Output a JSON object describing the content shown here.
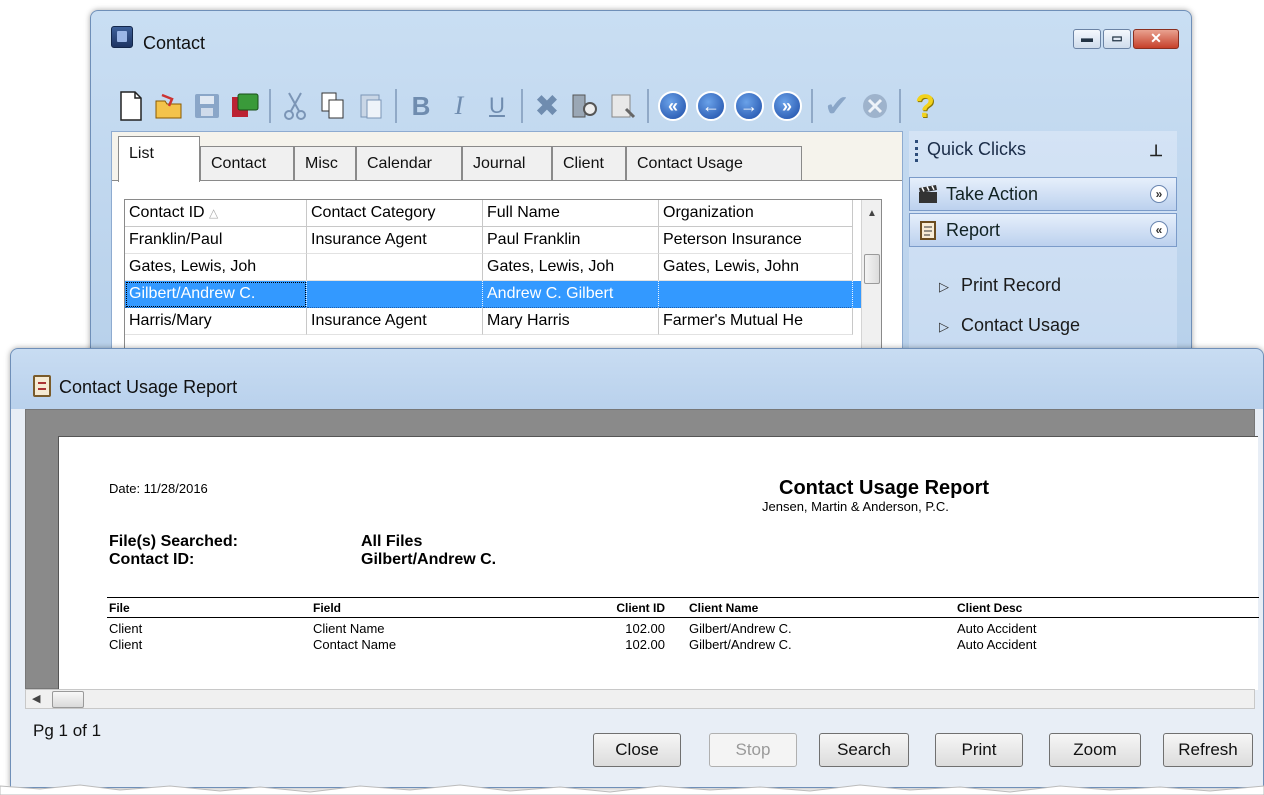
{
  "contact_window": {
    "title": "Contact",
    "toolbar": [
      "new-document-icon",
      "open-folder-icon",
      "save-icon",
      "notes-icon",
      "cut-icon",
      "copy-icon",
      "paste-icon",
      "bold-icon",
      "italic-icon",
      "underline-icon",
      "delete-icon",
      "search-record-icon",
      "attach-icon",
      "first-record-icon",
      "previous-record-icon",
      "next-record-icon",
      "last-record-icon",
      "check-icon",
      "cancel-icon",
      "help-icon"
    ],
    "tabs": [
      "List",
      "Contact",
      "Misc",
      "Calendar",
      "Journal",
      "Client",
      "Contact Usage"
    ],
    "grid": {
      "columns": [
        "Contact ID",
        "Contact Category",
        "Full Name",
        "Organization"
      ],
      "rows": [
        [
          "Franklin/Paul",
          "Insurance Agent",
          "Paul Franklin",
          "Peterson Insurance"
        ],
        [
          "Gates, Lewis, Joh",
          "",
          "Gates, Lewis, Joh",
          "Gates, Lewis, John"
        ],
        [
          "Gilbert/Andrew C.",
          "",
          "Andrew C. Gilbert",
          ""
        ],
        [
          "Harris/Mary",
          "Insurance Agent",
          "Mary Harris",
          "Farmer's Mutual He"
        ]
      ],
      "selected_row": 2
    },
    "quick_clicks": {
      "header": "Quick Clicks",
      "take_action": "Take Action",
      "report": "Report",
      "items": [
        "Print Record",
        "Contact Usage"
      ]
    }
  },
  "report_window": {
    "title": "Contact Usage Report",
    "page": {
      "date": "Date: 11/28/2016",
      "report_title": "Contact Usage Report",
      "firm": "Jensen, Martin & Anderson, P.C.",
      "files_searched_label": "File(s) Searched:",
      "files_searched_value": "All Files",
      "contact_id_label": "Contact ID:",
      "contact_id_value": "Gilbert/Andrew C.",
      "columns": [
        "File",
        "Field",
        "Client ID",
        "Client Name",
        "Client Desc"
      ],
      "rows": [
        [
          "Client",
          "Client Name",
          "102.00",
          "Gilbert/Andrew C.",
          "Auto Accident"
        ],
        [
          "Client",
          "Contact Name",
          "102.00",
          "Gilbert/Andrew C.",
          "Auto Accident"
        ]
      ]
    },
    "page_indicator": "Pg 1 of 1",
    "buttons": [
      "Close",
      "Stop",
      "Search",
      "Print",
      "Zoom",
      "Refresh"
    ]
  }
}
